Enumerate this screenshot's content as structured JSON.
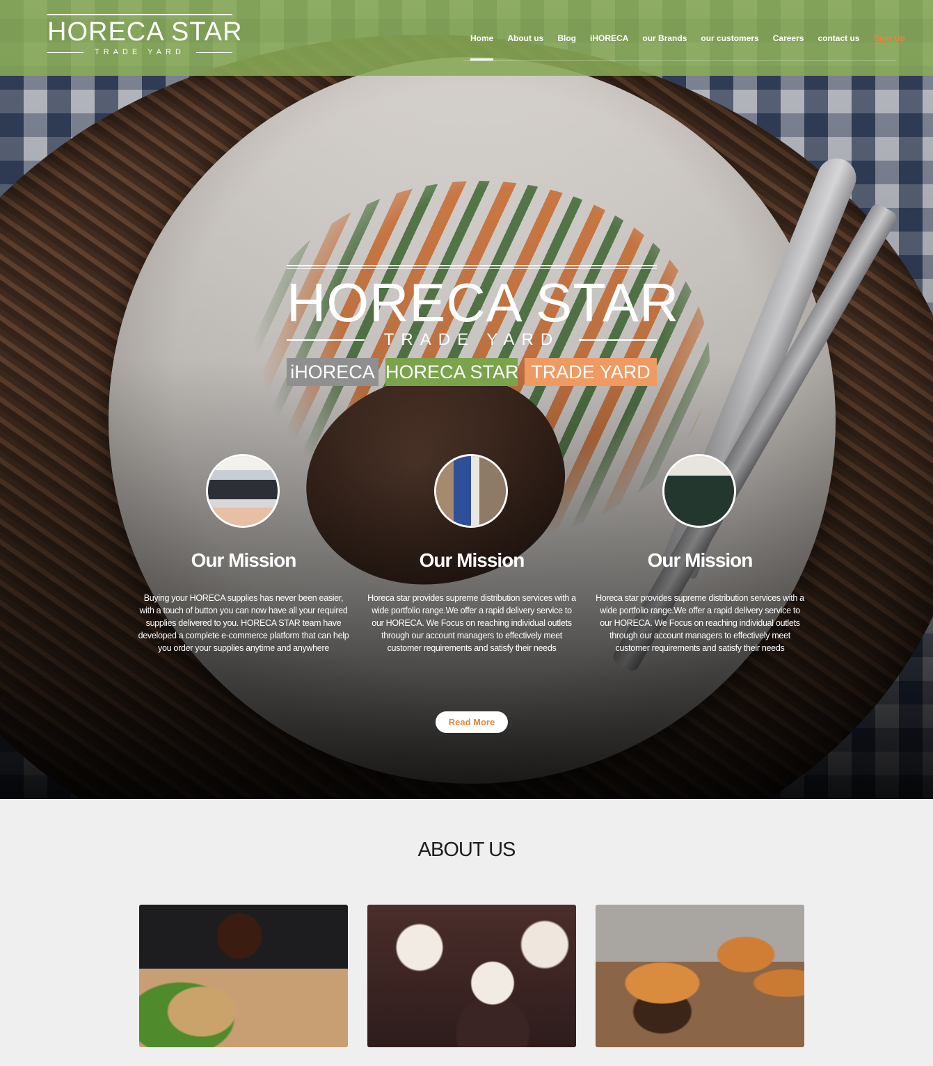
{
  "header": {
    "logo": {
      "main": "HORECA STAR",
      "sub": "TRADE YARD"
    },
    "nav": [
      {
        "label": "Home",
        "active": true
      },
      {
        "label": "About us"
      },
      {
        "label": "Blog"
      },
      {
        "label": "iHORECA"
      },
      {
        "label": "our Brands"
      },
      {
        "label": "our customers"
      },
      {
        "label": "Careers"
      },
      {
        "label": "contact us"
      },
      {
        "label": "Sign Up",
        "accent": "#e8863c"
      }
    ]
  },
  "hero": {
    "brand": {
      "main": "HORECA STAR",
      "sub": "TRADE YARD"
    },
    "badges": [
      {
        "label": "iHORECA",
        "color": "#8f8f8f"
      },
      {
        "label": "HORECA STAR",
        "color": "#7ba34b"
      },
      {
        "label": "TRADE YARD",
        "color": "#ef9a62"
      }
    ],
    "missions": [
      {
        "title": "Our Mission",
        "image": "laptop-shopping-photo",
        "text": "Buying your HORECA supplies has never been easier, with a touch of button you can now have all your required supplies delivered to you. HORECA STAR team have developed a complete e-commerce platform that can help you order your supplies anytime and anywhere"
      },
      {
        "title": "Our Mission",
        "image": "delivery-handshake-photo",
        "text": "Horeca star provides supreme distribution services with a wide portfolio range.We offer a rapid delivery service to our HORECA. We Focus on reaching individual outlets through our account managers to effectively meet customer requirements and satisfy their needs"
      },
      {
        "title": "Our Mission",
        "image": "storefront-photo",
        "text": "Horeca star provides supreme distribution services with a wide portfolio range.We offer a rapid delivery service to our HORECA. We Focus on reaching individual outlets through our account managers to effectively meet customer requirements and satisfy their needs"
      }
    ],
    "read_more": "Read More"
  },
  "about": {
    "title": "ABOUT US",
    "cards": [
      {
        "image": "burger-and-coffee-photo"
      },
      {
        "image": "cupcakes-photo"
      },
      {
        "image": "burgers-photo"
      }
    ]
  },
  "colors": {
    "header_green": "#87aa55",
    "accent_orange": "#e8863c",
    "page_bg": "#efeff0"
  }
}
